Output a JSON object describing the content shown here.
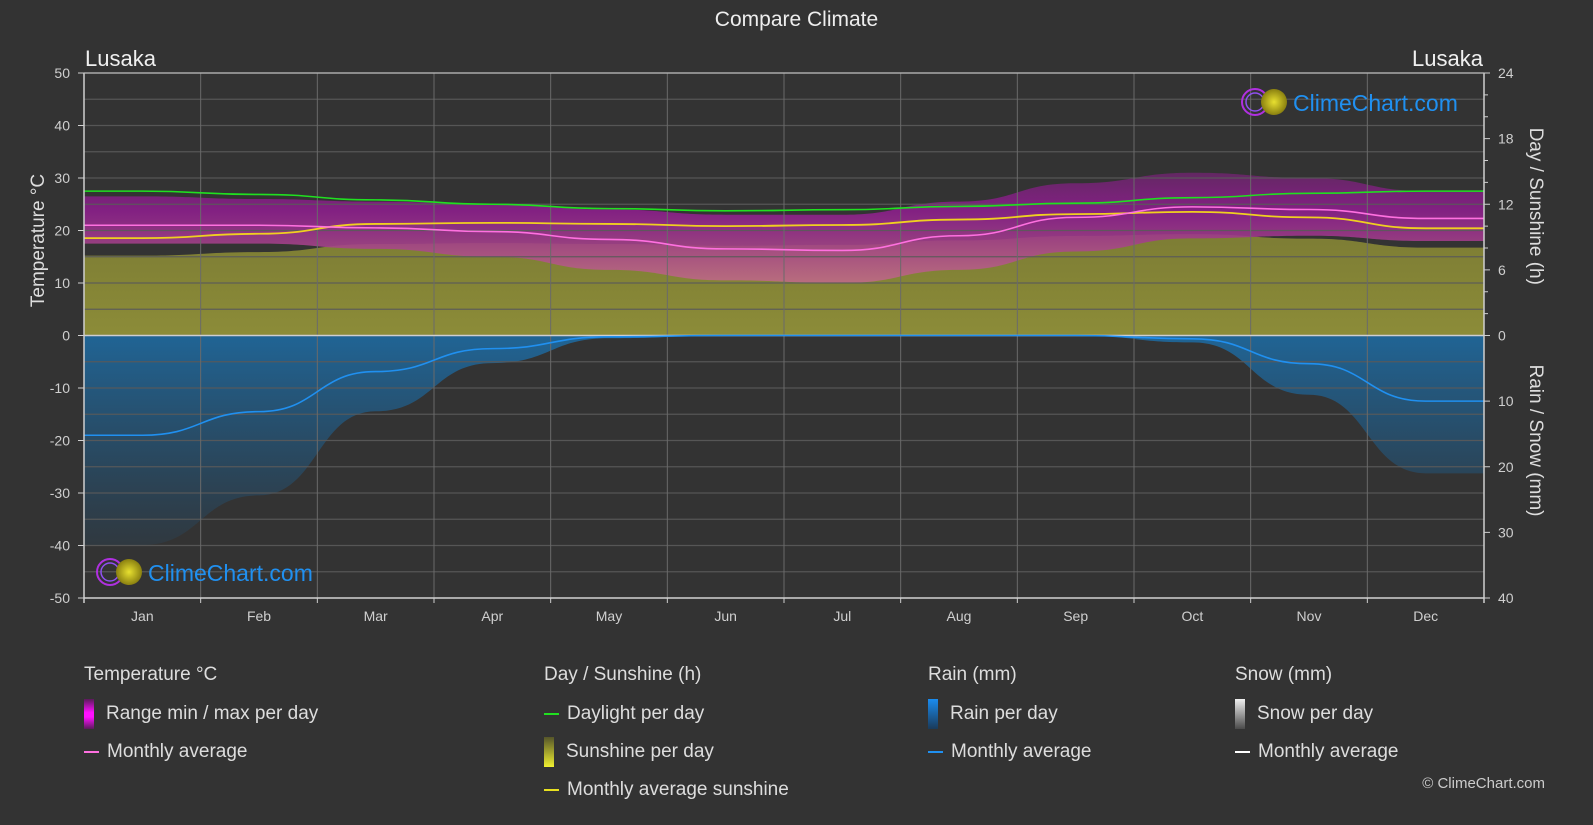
{
  "header": {
    "title": "Compare Climate",
    "city_left": "Lusaka",
    "city_right": "Lusaka"
  },
  "watermark": {
    "text": "ClimeChart.com"
  },
  "copyright": "© ClimeChart.com",
  "colors": {
    "background": "#333333",
    "temp_range": "#c020c0",
    "temp_avg": "#ff70e0",
    "daylight": "#20e020",
    "sunshine_fill": "#8a8a30",
    "sunshine_avg": "#f0d020",
    "rain_fill": "#1e6aa0",
    "rain_avg": "#2090f0",
    "snow_avg": "#ffffff",
    "brand": "#2090f0"
  },
  "legend": {
    "temperature": {
      "title": "Temperature °C",
      "items": [
        {
          "label": "Range min / max per day",
          "icon": "magenta-gradient-bar"
        },
        {
          "label": "Monthly average",
          "icon": "pink-line"
        }
      ]
    },
    "sunshine": {
      "title": "Day / Sunshine (h)",
      "items": [
        {
          "label": "Daylight per day",
          "icon": "green-line"
        },
        {
          "label": "Sunshine per day",
          "icon": "yellow-gradient-bar"
        },
        {
          "label": "Monthly average sunshine",
          "icon": "yellow-line"
        }
      ]
    },
    "rain": {
      "title": "Rain (mm)",
      "items": [
        {
          "label": "Rain per day",
          "icon": "blue-gradient-bar"
        },
        {
          "label": "Monthly average",
          "icon": "blue-line"
        }
      ]
    },
    "snow": {
      "title": "Snow (mm)",
      "items": [
        {
          "label": "Snow per day",
          "icon": "white-gradient-bar"
        },
        {
          "label": "Monthly average",
          "icon": "white-line"
        }
      ]
    }
  },
  "chart_data": {
    "type": "line",
    "title": "Compare Climate",
    "categories": [
      "Jan",
      "Feb",
      "Mar",
      "Apr",
      "May",
      "Jun",
      "Jul",
      "Aug",
      "Sep",
      "Oct",
      "Nov",
      "Dec"
    ],
    "axes": {
      "left": {
        "label": "Temperature °C",
        "range": [
          -50,
          50
        ],
        "ticks": [
          50,
          40,
          30,
          20,
          10,
          0,
          -10,
          -20,
          -30,
          -40,
          -50
        ]
      },
      "right_top": {
        "label": "Day / Sunshine (h)",
        "range": [
          0,
          24
        ],
        "ticks": [
          24,
          18,
          12,
          6,
          0
        ]
      },
      "right_bottom": {
        "label": "Rain / Snow (mm)",
        "range": [
          0,
          40
        ],
        "ticks": [
          0,
          10,
          20,
          30,
          40
        ]
      }
    },
    "grid": true,
    "series": [
      {
        "name": "Temperature monthly average (°C)",
        "axis": "left",
        "values": [
          21.0,
          21.0,
          20.5,
          19.8,
          18.3,
          16.5,
          16.2,
          19.0,
          22.5,
          24.5,
          24.0,
          22.3
        ]
      },
      {
        "name": "Temperature daily max approx (°C)",
        "axis": "left",
        "values": [
          26.5,
          26.0,
          25.5,
          25.0,
          24.0,
          23.0,
          23.0,
          25.5,
          29.0,
          31.0,
          30.0,
          27.5
        ]
      },
      {
        "name": "Temperature daily min approx (°C)",
        "axis": "left",
        "values": [
          17.5,
          17.5,
          16.5,
          15.0,
          12.5,
          10.5,
          10.0,
          12.5,
          16.0,
          18.5,
          19.0,
          18.0
        ]
      },
      {
        "name": "Daylight per day (h)",
        "axis": "right_top",
        "values": [
          13.2,
          12.9,
          12.4,
          12.0,
          11.6,
          11.4,
          11.5,
          11.8,
          12.1,
          12.6,
          13.0,
          13.2
        ]
      },
      {
        "name": "Monthly average sunshine (h)",
        "axis": "right_top",
        "values": [
          8.9,
          9.3,
          10.2,
          10.3,
          10.2,
          10.0,
          10.1,
          10.6,
          11.1,
          11.3,
          10.8,
          9.8
        ]
      },
      {
        "name": "Rain monthly average (mm)",
        "axis": "right_bottom",
        "values": [
          15.2,
          11.6,
          5.5,
          2.0,
          0.2,
          0.0,
          0.0,
          0.0,
          0.0,
          0.5,
          4.3,
          10.0
        ]
      },
      {
        "name": "Snow monthly average (mm)",
        "axis": "right_bottom",
        "values": [
          0,
          0,
          0,
          0,
          0,
          0,
          0,
          0,
          0,
          0,
          0,
          0
        ]
      }
    ]
  }
}
